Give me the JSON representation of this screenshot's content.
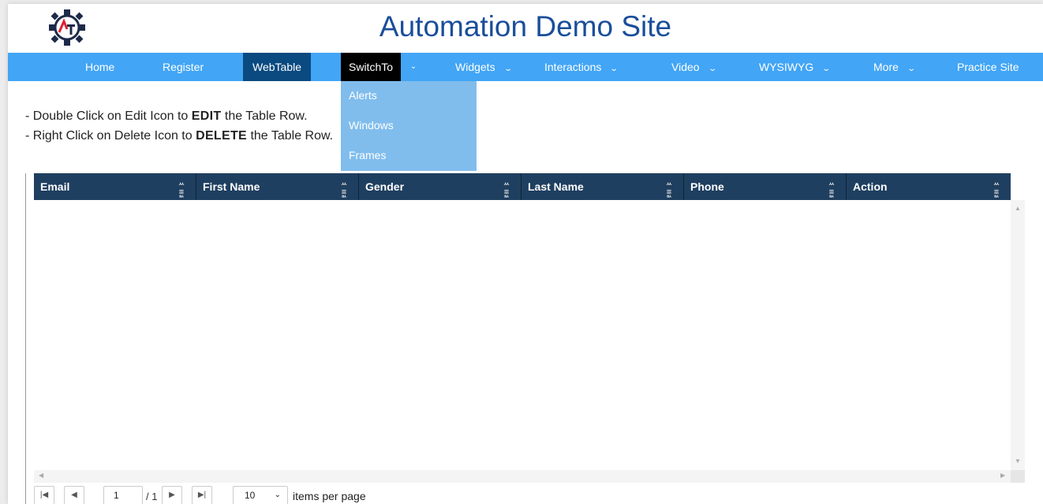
{
  "header": {
    "title": "Automation Demo Site"
  },
  "nav": {
    "items": [
      "Home",
      "Register",
      "WebTable",
      "SwitchTo",
      "Widgets",
      "Interactions",
      "Video",
      "WYSIWYG",
      "More",
      "Practice Site"
    ],
    "chevron": "⌄"
  },
  "dropdown": {
    "items": [
      "Alerts",
      "Windows",
      "Frames"
    ]
  },
  "instructions": {
    "line1_prefix": "- Double Click on Edit Icon to ",
    "line1_bold": "EDIT",
    "line1_suffix": " the Table Row.",
    "line2_prefix": "- Right Click on Delete Icon to ",
    "line2_bold": "DELETE",
    "line2_suffix": " the Table Row."
  },
  "grid": {
    "columns": [
      "Email",
      "First Name",
      "Gender",
      "Last Name",
      "Phone",
      "Action"
    ],
    "column_icon": "sort-filter-icon",
    "rows": []
  },
  "pager": {
    "first": "|◀",
    "prev": "◀",
    "next": "▶",
    "last": "▶|",
    "page_value": "1",
    "total_text": "/ 1",
    "page_size": "10",
    "items_label": "items per page"
  },
  "colors": {
    "nav_bg": "#42a5f5",
    "grid_header": "#1f3f60",
    "title": "#1a4e9a",
    "active_nav": "#0a4a80"
  }
}
